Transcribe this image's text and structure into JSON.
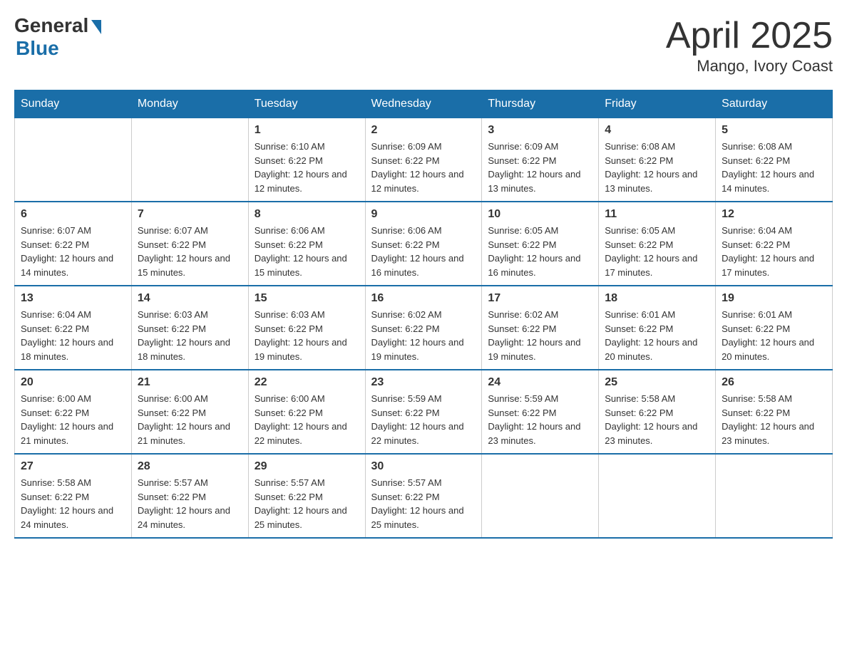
{
  "logo": {
    "general": "General",
    "blue": "Blue"
  },
  "title": {
    "month_year": "April 2025",
    "location": "Mango, Ivory Coast"
  },
  "days_of_week": [
    "Sunday",
    "Monday",
    "Tuesday",
    "Wednesday",
    "Thursday",
    "Friday",
    "Saturday"
  ],
  "weeks": [
    [
      {
        "day": "",
        "sunrise": "",
        "sunset": "",
        "daylight": ""
      },
      {
        "day": "",
        "sunrise": "",
        "sunset": "",
        "daylight": ""
      },
      {
        "day": "1",
        "sunrise": "Sunrise: 6:10 AM",
        "sunset": "Sunset: 6:22 PM",
        "daylight": "Daylight: 12 hours and 12 minutes."
      },
      {
        "day": "2",
        "sunrise": "Sunrise: 6:09 AM",
        "sunset": "Sunset: 6:22 PM",
        "daylight": "Daylight: 12 hours and 12 minutes."
      },
      {
        "day": "3",
        "sunrise": "Sunrise: 6:09 AM",
        "sunset": "Sunset: 6:22 PM",
        "daylight": "Daylight: 12 hours and 13 minutes."
      },
      {
        "day": "4",
        "sunrise": "Sunrise: 6:08 AM",
        "sunset": "Sunset: 6:22 PM",
        "daylight": "Daylight: 12 hours and 13 minutes."
      },
      {
        "day": "5",
        "sunrise": "Sunrise: 6:08 AM",
        "sunset": "Sunset: 6:22 PM",
        "daylight": "Daylight: 12 hours and 14 minutes."
      }
    ],
    [
      {
        "day": "6",
        "sunrise": "Sunrise: 6:07 AM",
        "sunset": "Sunset: 6:22 PM",
        "daylight": "Daylight: 12 hours and 14 minutes."
      },
      {
        "day": "7",
        "sunrise": "Sunrise: 6:07 AM",
        "sunset": "Sunset: 6:22 PM",
        "daylight": "Daylight: 12 hours and 15 minutes."
      },
      {
        "day": "8",
        "sunrise": "Sunrise: 6:06 AM",
        "sunset": "Sunset: 6:22 PM",
        "daylight": "Daylight: 12 hours and 15 minutes."
      },
      {
        "day": "9",
        "sunrise": "Sunrise: 6:06 AM",
        "sunset": "Sunset: 6:22 PM",
        "daylight": "Daylight: 12 hours and 16 minutes."
      },
      {
        "day": "10",
        "sunrise": "Sunrise: 6:05 AM",
        "sunset": "Sunset: 6:22 PM",
        "daylight": "Daylight: 12 hours and 16 minutes."
      },
      {
        "day": "11",
        "sunrise": "Sunrise: 6:05 AM",
        "sunset": "Sunset: 6:22 PM",
        "daylight": "Daylight: 12 hours and 17 minutes."
      },
      {
        "day": "12",
        "sunrise": "Sunrise: 6:04 AM",
        "sunset": "Sunset: 6:22 PM",
        "daylight": "Daylight: 12 hours and 17 minutes."
      }
    ],
    [
      {
        "day": "13",
        "sunrise": "Sunrise: 6:04 AM",
        "sunset": "Sunset: 6:22 PM",
        "daylight": "Daylight: 12 hours and 18 minutes."
      },
      {
        "day": "14",
        "sunrise": "Sunrise: 6:03 AM",
        "sunset": "Sunset: 6:22 PM",
        "daylight": "Daylight: 12 hours and 18 minutes."
      },
      {
        "day": "15",
        "sunrise": "Sunrise: 6:03 AM",
        "sunset": "Sunset: 6:22 PM",
        "daylight": "Daylight: 12 hours and 19 minutes."
      },
      {
        "day": "16",
        "sunrise": "Sunrise: 6:02 AM",
        "sunset": "Sunset: 6:22 PM",
        "daylight": "Daylight: 12 hours and 19 minutes."
      },
      {
        "day": "17",
        "sunrise": "Sunrise: 6:02 AM",
        "sunset": "Sunset: 6:22 PM",
        "daylight": "Daylight: 12 hours and 19 minutes."
      },
      {
        "day": "18",
        "sunrise": "Sunrise: 6:01 AM",
        "sunset": "Sunset: 6:22 PM",
        "daylight": "Daylight: 12 hours and 20 minutes."
      },
      {
        "day": "19",
        "sunrise": "Sunrise: 6:01 AM",
        "sunset": "Sunset: 6:22 PM",
        "daylight": "Daylight: 12 hours and 20 minutes."
      }
    ],
    [
      {
        "day": "20",
        "sunrise": "Sunrise: 6:00 AM",
        "sunset": "Sunset: 6:22 PM",
        "daylight": "Daylight: 12 hours and 21 minutes."
      },
      {
        "day": "21",
        "sunrise": "Sunrise: 6:00 AM",
        "sunset": "Sunset: 6:22 PM",
        "daylight": "Daylight: 12 hours and 21 minutes."
      },
      {
        "day": "22",
        "sunrise": "Sunrise: 6:00 AM",
        "sunset": "Sunset: 6:22 PM",
        "daylight": "Daylight: 12 hours and 22 minutes."
      },
      {
        "day": "23",
        "sunrise": "Sunrise: 5:59 AM",
        "sunset": "Sunset: 6:22 PM",
        "daylight": "Daylight: 12 hours and 22 minutes."
      },
      {
        "day": "24",
        "sunrise": "Sunrise: 5:59 AM",
        "sunset": "Sunset: 6:22 PM",
        "daylight": "Daylight: 12 hours and 23 minutes."
      },
      {
        "day": "25",
        "sunrise": "Sunrise: 5:58 AM",
        "sunset": "Sunset: 6:22 PM",
        "daylight": "Daylight: 12 hours and 23 minutes."
      },
      {
        "day": "26",
        "sunrise": "Sunrise: 5:58 AM",
        "sunset": "Sunset: 6:22 PM",
        "daylight": "Daylight: 12 hours and 23 minutes."
      }
    ],
    [
      {
        "day": "27",
        "sunrise": "Sunrise: 5:58 AM",
        "sunset": "Sunset: 6:22 PM",
        "daylight": "Daylight: 12 hours and 24 minutes."
      },
      {
        "day": "28",
        "sunrise": "Sunrise: 5:57 AM",
        "sunset": "Sunset: 6:22 PM",
        "daylight": "Daylight: 12 hours and 24 minutes."
      },
      {
        "day": "29",
        "sunrise": "Sunrise: 5:57 AM",
        "sunset": "Sunset: 6:22 PM",
        "daylight": "Daylight: 12 hours and 25 minutes."
      },
      {
        "day": "30",
        "sunrise": "Sunrise: 5:57 AM",
        "sunset": "Sunset: 6:22 PM",
        "daylight": "Daylight: 12 hours and 25 minutes."
      },
      {
        "day": "",
        "sunrise": "",
        "sunset": "",
        "daylight": ""
      },
      {
        "day": "",
        "sunrise": "",
        "sunset": "",
        "daylight": ""
      },
      {
        "day": "",
        "sunrise": "",
        "sunset": "",
        "daylight": ""
      }
    ]
  ]
}
